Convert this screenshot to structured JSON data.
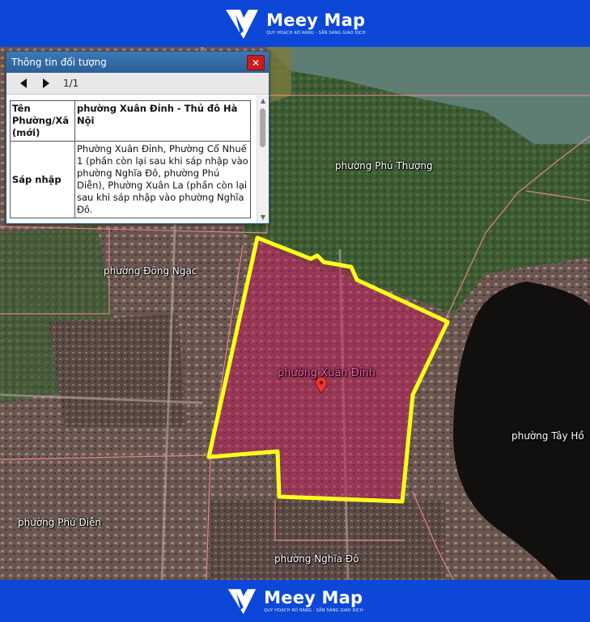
{
  "brand": {
    "name": "Meey Map",
    "tagline_top": "QUY HOẠCH RÕ RÀNG - SẴN SÀNG GIAO DỊCH",
    "tagline_bottom": "QUY HOẠCH RÕ RÀNG - SẴN SÀNG GIAO DỊCH"
  },
  "panel": {
    "title": "Thông tin đối tượng",
    "close_label": "✕",
    "page_indicator": "1/1",
    "rows": [
      {
        "key": "Tên Phường/Xã (mới)",
        "value": "phường Xuân Đỉnh - Thủ đô Hà Nội"
      },
      {
        "key": "Sáp nhập",
        "value": "Phường Xuân Đỉnh, Phường Cổ Nhuế 1 (phần còn lại sau khi sáp nhập vào phường Nghĩa Đô, phường Phú Diễn), Phường Xuân La (phần còn lại sau khi sáp nhập vào phường Nghĩa Đô."
      }
    ]
  },
  "map": {
    "highlight_color": "#ffff1a",
    "highlight_fill": "#c2185b",
    "boundary_color": "#f08a8a",
    "labels": {
      "phu_thuong": "phường Phú Thượng",
      "dong_ngac": "phường Đông Ngạc",
      "xuan_dinh": "phường Xuân Đỉnh",
      "tay_ho": "phường Tây Hồ",
      "phu_dien": "phường Phú Diễn",
      "nghia_do": "phường Nghĩa Đô"
    }
  }
}
